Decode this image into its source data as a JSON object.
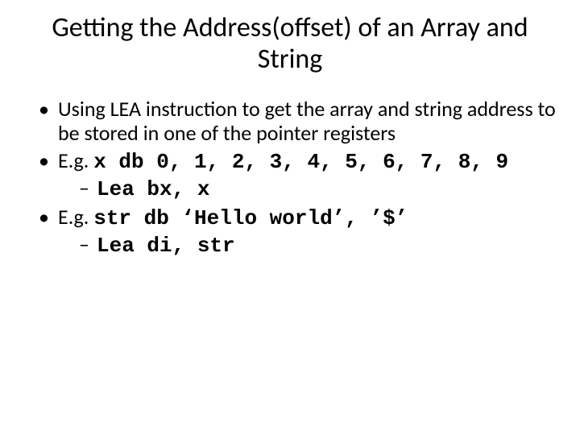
{
  "title": "Getting the Address(offset) of an Array and String",
  "bullets": [
    {
      "text": "Using LEA instruction to get the array and string address to be stored in one of the pointer registers"
    },
    {
      "prefix": "E.g. ",
      "code": "x db 0, 1, 2, 3, 4, 5, 6, 7, 8, 9",
      "sub": [
        "Lea bx, x"
      ]
    },
    {
      "prefix": "E.g. ",
      "code": "str db ‘Hello world’, ’$’",
      "sub": [
        "Lea di, str"
      ]
    }
  ]
}
